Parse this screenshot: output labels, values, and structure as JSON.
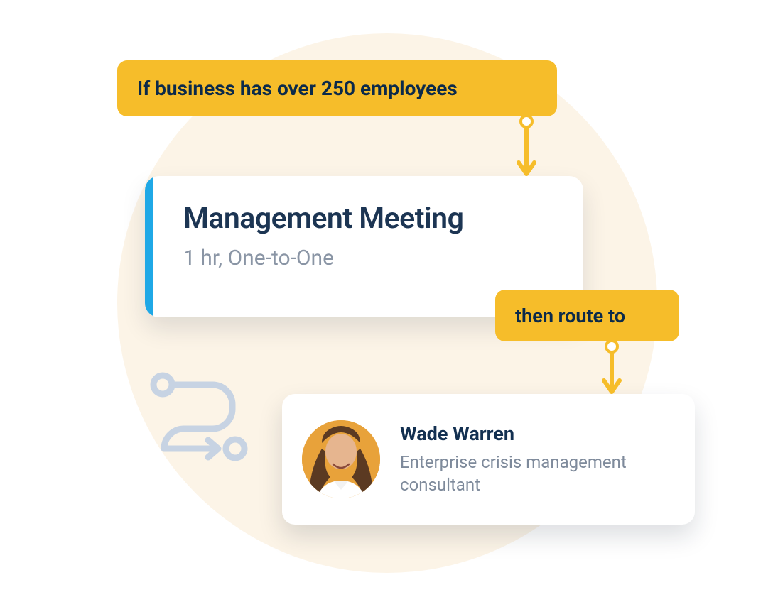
{
  "colors": {
    "background_circle": "#FCF4E7",
    "tag_bg": "#F6BD2A",
    "tag_text": "#0B2A4A",
    "accent_blue": "#1FA8E6",
    "text_dark": "#1C3553",
    "text_muted": "#8A95A5"
  },
  "condition": {
    "label": "If business has over 250 employees"
  },
  "meeting": {
    "title": "Management Meeting",
    "subtitle": "1 hr, One-to-One"
  },
  "route": {
    "label": "then route to"
  },
  "person": {
    "name": "Wade Warren",
    "role": "Enterprise crisis management consultant"
  },
  "icons": {
    "route_path": "route-path-icon",
    "arrow_down": "arrow-down-icon",
    "avatar": "avatar-image"
  }
}
